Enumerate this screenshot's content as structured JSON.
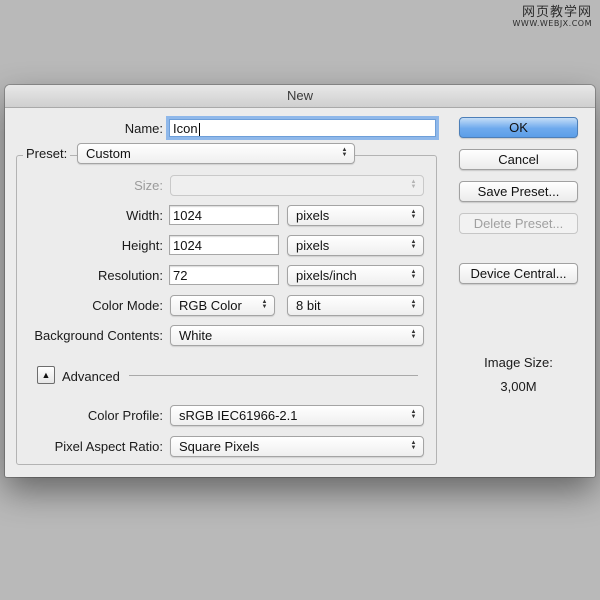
{
  "watermark": {
    "main": "网页教学网",
    "sub": "WWW.WEBJX.COM"
  },
  "dialog": {
    "title": "New",
    "name": {
      "label": "Name:",
      "value": "Icon"
    },
    "preset": {
      "label": "Preset:",
      "value": "Custom"
    },
    "size": {
      "label": "Size:",
      "value": ""
    },
    "width": {
      "label": "Width:",
      "value": "1024",
      "unit": "pixels"
    },
    "height": {
      "label": "Height:",
      "value": "1024",
      "unit": "pixels"
    },
    "resolution": {
      "label": "Resolution:",
      "value": "72",
      "unit": "pixels/inch"
    },
    "color_mode": {
      "label": "Color Mode:",
      "value": "RGB Color",
      "depth": "8 bit"
    },
    "background": {
      "label": "Background Contents:",
      "value": "White"
    },
    "advanced": {
      "label": "Advanced",
      "toggle_glyph": "▲"
    },
    "color_profile": {
      "label": "Color Profile:",
      "value": "sRGB IEC61966-2.1"
    },
    "pixel_aspect": {
      "label": "Pixel Aspect Ratio:",
      "value": "Square Pixels"
    },
    "buttons": {
      "ok": "OK",
      "cancel": "Cancel",
      "save_preset": "Save Preset...",
      "delete_preset": "Delete Preset...",
      "device_central": "Device Central..."
    },
    "image_size": {
      "label": "Image Size:",
      "value": "3,00M"
    }
  },
  "colors": {
    "background": "#b9b9b9",
    "dialog": "#ececec",
    "primary_button": "#6eaaed",
    "focus_ring": "#8fb8ea"
  },
  "icons": {
    "select_arrows": "up-down-arrows-icon",
    "disclosure": "disclosure-triangle-icon"
  }
}
